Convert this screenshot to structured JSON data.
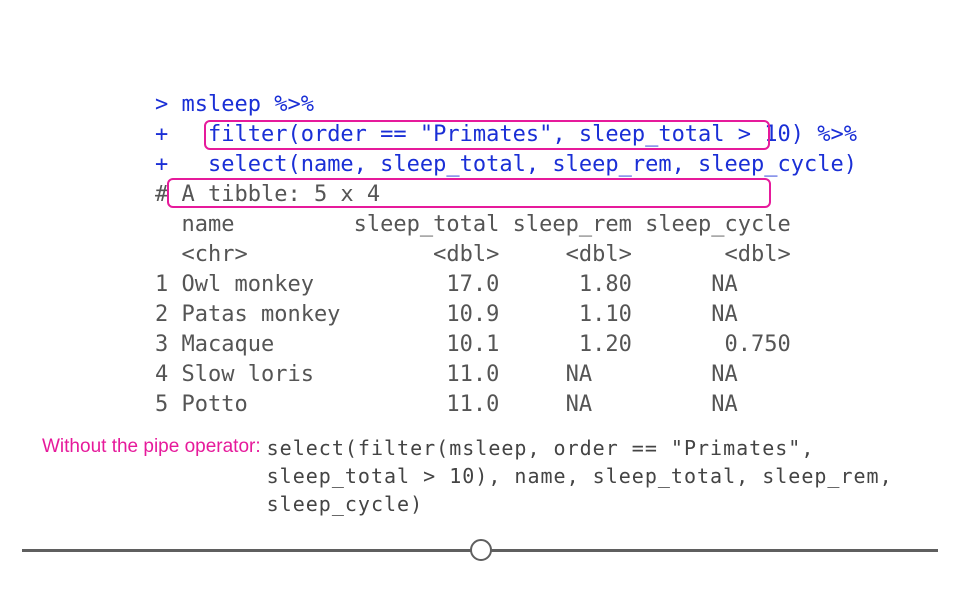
{
  "code": {
    "l1_prompt": "> ",
    "l1_code": "msleep %>%",
    "l2_prompt": "+   ",
    "l2_code": "filter(order == \"Primates\", sleep_total > 10) %>%",
    "l3_prompt": "+   ",
    "l3_code": "select(name, sleep_total, sleep_rem, sleep_cycle)"
  },
  "tibble_info": "# A tibble: 5 x 4",
  "header_names": "  name         sleep_total sleep_rem sleep_cycle",
  "header_types": "  <chr>              <dbl>     <dbl>       <dbl>",
  "rows": {
    "r1": "1 Owl monkey          17.0      1.80      NA    ",
    "r2": "2 Patas monkey        10.9      1.10      NA    ",
    "r3": "3 Macaque             10.1      1.20       0.750",
    "r4": "4 Slow loris          11.0     NA         NA    ",
    "r5": "5 Potto               11.0     NA         NA    "
  },
  "note": {
    "label": "Without the pipe operator:",
    "line1": "select(filter(msleep, order == \"Primates\",",
    "line2": "sleep_total > 10), name, sleep_total, sleep_rem,",
    "line3": "sleep_cycle)"
  }
}
